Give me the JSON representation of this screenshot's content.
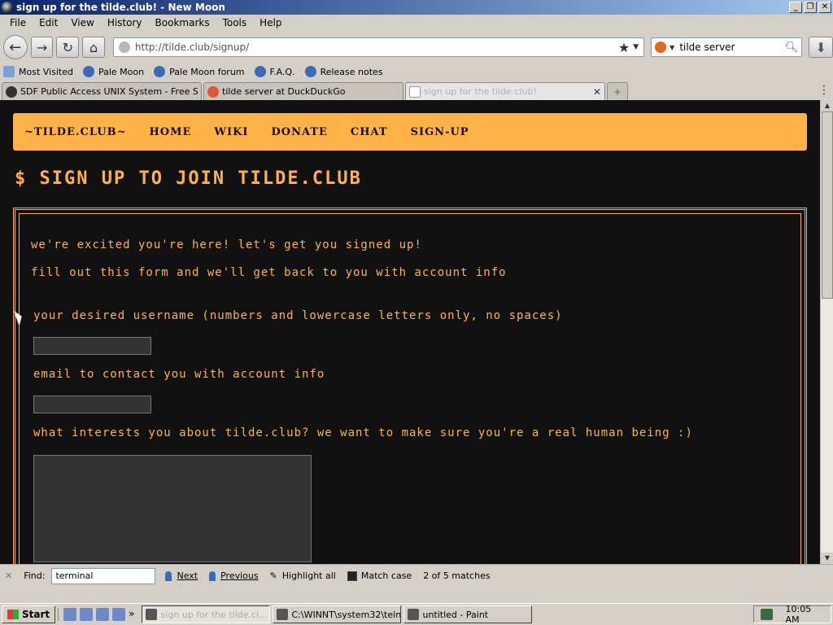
{
  "window": {
    "title": "sign up for the tilde.club! - New Moon",
    "buttons": [
      "_",
      "❐",
      "✕"
    ]
  },
  "menu": [
    "File",
    "Edit",
    "View",
    "History",
    "Bookmarks",
    "Tools",
    "Help"
  ],
  "navigation": {
    "url": "http://tilde.club/signup/",
    "search_text": "tilde server"
  },
  "bookmarks": [
    "Most Visited",
    "Pale Moon",
    "Pale Moon forum",
    "F.A.Q.",
    "Release notes"
  ],
  "tabs": [
    {
      "label": "SDF Public Access UNIX System - Free Sh...",
      "active": false
    },
    {
      "label": "tilde server at DuckDuckGo",
      "active": false
    },
    {
      "label": "sign up for the tilde.club!",
      "active": true
    }
  ],
  "site": {
    "nav": [
      "~TILDE.CLUB~",
      "HOME",
      "WIKI",
      "DONATE",
      "CHAT",
      "SIGN-UP"
    ],
    "heading": "$ SIGN UP TO JOIN TILDE.CLUB",
    "intro1": "we're excited you're here! let's get you signed up!",
    "intro2": "fill out this form and we'll get back to you with account info",
    "username_label": "your desired username (numbers and lowercase letters only, no spaces)",
    "email_label": "email to contact you with account info",
    "interest_label": "what interests you about tilde.club? we want to make sure you're a real human being :)"
  },
  "findbar": {
    "label": "Find:",
    "query": "terminal",
    "next": "Next",
    "previous": "Previous",
    "highlight_all": "Highlight all",
    "match_case": "Match case",
    "status": "2 of 5 matches"
  },
  "taskbar": {
    "start": "Start",
    "tasks": [
      "sign up for the tilde.cl...",
      "C:\\WINNT\\system32\\teln...",
      "untitled - Paint"
    ],
    "clock": "10:05 AM"
  }
}
